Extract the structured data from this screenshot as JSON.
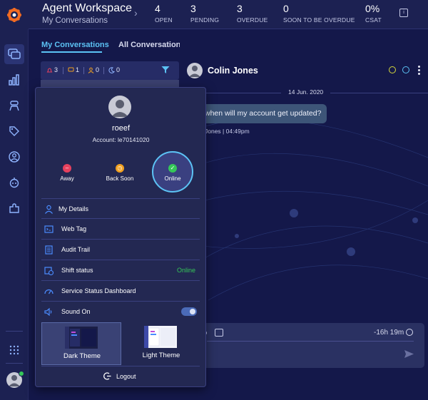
{
  "header": {
    "app_title": "Agent Workspace",
    "app_subtitle": "My Conversations",
    "stats": [
      {
        "value": "4",
        "label": "OPEN"
      },
      {
        "value": "3",
        "label": "PENDING"
      },
      {
        "value": "3",
        "label": "OVERDUE"
      },
      {
        "value": "0",
        "label": "SOON TO BE OVERDUE"
      },
      {
        "value": "0%",
        "label": "CSAT"
      }
    ]
  },
  "tabs": [
    {
      "label": "My Conversations",
      "active": true
    },
    {
      "label": "All Conversations",
      "active": false
    }
  ],
  "counters": [
    "3",
    "1",
    "0",
    "0"
  ],
  "conversation": {
    "contact_name": "Colin Jones",
    "date": "14 Jun. 2020",
    "message": "when will my account get updated?",
    "message_meta": "Jones  |  04:49pm",
    "timer": "-16h 19m"
  },
  "profile_popup": {
    "username": "roeef",
    "account": "Account: le70141020",
    "statuses": [
      {
        "label": "Away",
        "color": "#e6415e"
      },
      {
        "label": "Back Soon",
        "color": "#f0a020"
      },
      {
        "label": "Online",
        "color": "#35c759",
        "selected": true
      }
    ],
    "menu": [
      {
        "label": "My Details",
        "icon": "user-icon"
      },
      {
        "label": "Web Tag",
        "icon": "web-tag-icon"
      },
      {
        "label": "Audit Trail",
        "icon": "audit-trail-icon"
      },
      {
        "label": "Shift status",
        "icon": "shift-status-icon",
        "value": "Online"
      },
      {
        "label": "Service Status Dashboard",
        "icon": "dashboard-icon"
      },
      {
        "label": "Sound On",
        "icon": "speaker-icon",
        "toggle": true
      }
    ],
    "themes": [
      {
        "label": "Dark Theme",
        "selected": true
      },
      {
        "label": "Light Theme",
        "selected": false
      }
    ],
    "logout_label": "Logout"
  },
  "colors": {
    "accent": "#5cc3f5",
    "online": "#35c759",
    "background": "#14184a",
    "panel": "#232852"
  }
}
